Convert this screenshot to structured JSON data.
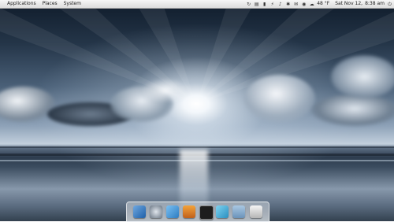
{
  "top_panel": {
    "menus": [
      "Applications",
      "Places",
      "System"
    ],
    "tray": {
      "weather_temp": "48 °F",
      "date": "Sat Nov 12,",
      "time": "8:38 am"
    }
  },
  "dock": {
    "items": [
      {
        "name": "finder"
      },
      {
        "name": "system-preferences"
      },
      {
        "name": "chat"
      },
      {
        "name": "vlc"
      },
      {
        "name": "terminal"
      },
      {
        "name": "paint"
      },
      {
        "name": "files"
      },
      {
        "name": "trash"
      }
    ]
  }
}
